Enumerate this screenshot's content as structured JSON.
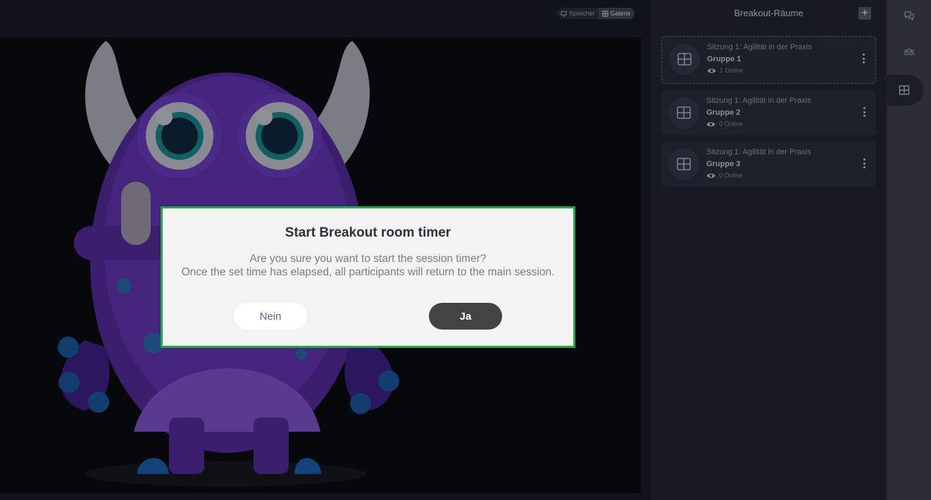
{
  "view_toggle": {
    "speaker_label": "Sprecher",
    "gallery_label": "Galerie",
    "active": "gallery"
  },
  "panel": {
    "title": "Breakout-Räume",
    "add_label": "+",
    "rooms": [
      {
        "session": "Sitzung 1: Agilität in der Praxis",
        "name": "Gruppe 1",
        "status": "1 Online",
        "active": true
      },
      {
        "session": "Sitzung 1: Agilität in der Praxis",
        "name": "Gruppe 2",
        "status": "0 Online",
        "active": false
      },
      {
        "session": "Sitzung 1: Agilität in der Praxis",
        "name": "Gruppe 3",
        "status": "0 Online",
        "active": false
      }
    ]
  },
  "rail": {
    "items": [
      {
        "icon": "chat-icon"
      },
      {
        "icon": "participants-icon"
      },
      {
        "icon": "breakout-rooms-icon",
        "active": true
      }
    ]
  },
  "modal": {
    "title": "Start Breakout room timer",
    "line1": "Are you sure you want to start the session timer?",
    "line2": "Once the set time has elapsed, all participants will return to the main session.",
    "cancel_label": "Nein",
    "confirm_label": "Ja"
  },
  "colors": {
    "modal_border": "#23a948",
    "confirm_bg": "#434343",
    "panel_bg": "#171a23",
    "monster_purple": "#5b2a9e"
  }
}
